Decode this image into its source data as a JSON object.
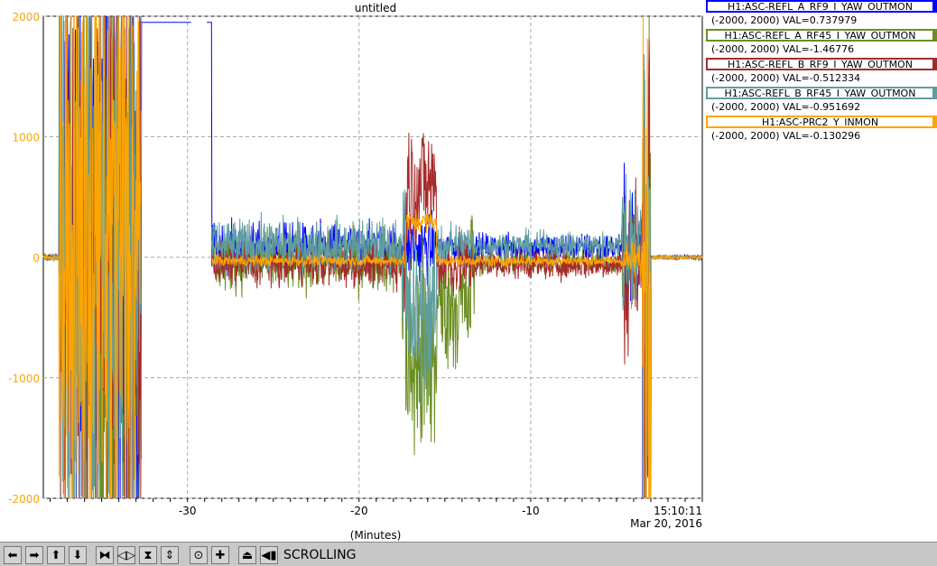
{
  "chart_data": {
    "type": "line",
    "title": "untitled",
    "xlabel": "(Minutes)",
    "xlim": [
      -38.4,
      0
    ],
    "ylim": [
      -2000,
      2000
    ],
    "x_ticks": [
      {
        "value": -30,
        "label": "-30"
      },
      {
        "value": -20,
        "label": "-20"
      },
      {
        "value": -10,
        "label": "-10"
      }
    ],
    "x_end_label": [
      "15:10:11",
      "Mar 20, 2016"
    ],
    "y_ticks": [
      {
        "value": 2000,
        "label": "2000"
      },
      {
        "value": 1000,
        "label": "1000"
      },
      {
        "value": 0,
        "label": "0"
      },
      {
        "value": -1000,
        "label": "-1000"
      },
      {
        "value": -2000,
        "label": "-2000"
      }
    ],
    "grid": true,
    "legend_position": "right",
    "series": [
      {
        "name": "H1:ASC-REFL_A_RF9_I_YAW_OUTMON",
        "range_val": "(-2000, 2000) VAL=0.737979",
        "color": "#0000ff"
      },
      {
        "name": "H1:ASC-REFL_A_RF45_I_YAW_OUTMON",
        "range_val": "(-2000, 2000) VAL=-1.46776",
        "color": "#6b8e23"
      },
      {
        "name": "H1:ASC-REFL_B_RF9_I_YAW_OUTMON",
        "range_val": "(-2000, 2000) VAL=-0.512334",
        "color": "#a52a2a"
      },
      {
        "name": "H1:ASC-REFL_B_RF45_I_YAW_OUTMON",
        "range_val": "(-2000, 2000) VAL=-0.951692",
        "color": "#5f9ea0"
      },
      {
        "name": "H1:ASC-PRC2_Y_INMON",
        "range_val": "(-2000, 2000) VAL=-0.130296",
        "color": "#ffa500"
      }
    ]
  },
  "toolbar": {
    "status": "SCROLLING",
    "buttons": [
      {
        "icon": "arrow-left-icon",
        "glyph": "⬅"
      },
      {
        "icon": "arrow-right-icon",
        "glyph": "➡"
      },
      {
        "icon": "arrow-up-icon",
        "glyph": "⬆"
      },
      {
        "icon": "arrow-down-icon",
        "glyph": "⬇"
      },
      {
        "icon": "compress-horizontal-icon",
        "glyph": "⧓"
      },
      {
        "icon": "expand-horizontal-icon",
        "glyph": "◁▷"
      },
      {
        "icon": "compress-vertical-icon",
        "glyph": "⧗"
      },
      {
        "icon": "expand-vertical-icon",
        "glyph": "⇕"
      },
      {
        "icon": "autoscale-icon",
        "glyph": "⊙"
      },
      {
        "icon": "zoom-in-icon",
        "glyph": "✚"
      },
      {
        "icon": "toggle-scroll-icon",
        "glyph": "⏏"
      },
      {
        "icon": "rewind-icon",
        "glyph": "◀▮"
      }
    ]
  }
}
